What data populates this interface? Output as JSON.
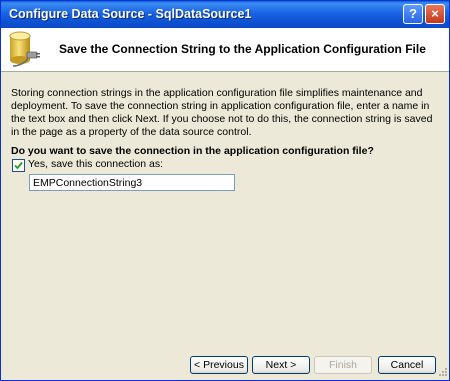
{
  "window": {
    "title": "Configure Data Source - SqlDataSource1",
    "help_label": "?",
    "close_label": "×"
  },
  "header": {
    "title": "Save the Connection String to the Application Configuration File"
  },
  "main": {
    "description": "Storing connection strings in the application configuration file simplifies maintenance and deployment. To save the connection string in application configuration file, enter a name in the text box and then click Next. If you choose not to do this, the connection string is saved in the page as a property of the data source control.",
    "question": "Do you want to save the connection in the application configuration file?",
    "save_checkbox": {
      "label": "Yes, save this connection as:",
      "checked": true
    },
    "connection_name": {
      "value": "EMPConnectionString3"
    }
  },
  "footer": {
    "previous_label": "< Previous",
    "next_label": "Next >",
    "finish_label": "Finish",
    "cancel_label": "Cancel",
    "finish_enabled": false
  },
  "colors": {
    "titlebar": "#0E52D3",
    "dialog_bg": "#ECE9D8",
    "header_bg": "#FFFFFF"
  }
}
